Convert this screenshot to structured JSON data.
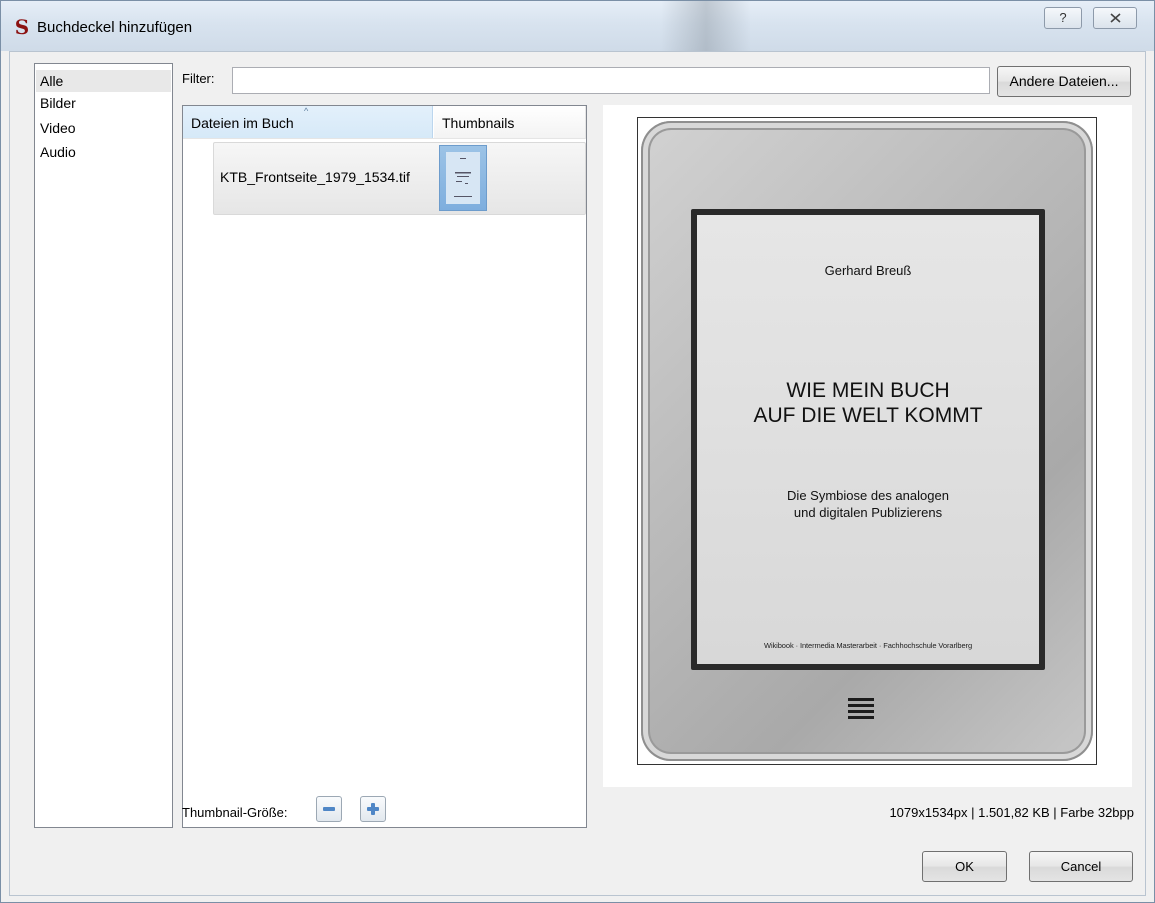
{
  "window": {
    "title": "Buchdeckel hinzufügen",
    "app_icon_glyph": "S",
    "help_glyph": "?"
  },
  "categories": [
    {
      "label": "Alle",
      "selected": true
    },
    {
      "label": "Bilder",
      "selected": false
    },
    {
      "label": "Video",
      "selected": false
    },
    {
      "label": "Audio",
      "selected": false
    }
  ],
  "filter": {
    "label": "Filter:",
    "value": "",
    "other_files_button": "Andere Dateien..."
  },
  "file_list": {
    "columns": [
      "Dateien im Buch",
      "Thumbnails"
    ],
    "rows": [
      {
        "filename": "KTB_Frontseite_1979_1534.tif"
      }
    ]
  },
  "thumbnail_size": {
    "label": "Thumbnail-Größe:"
  },
  "preview": {
    "author": "Gerhard Breuß",
    "title_line1": "WIE MEIN BUCH",
    "title_line2": "AUF DIE WELT KOMMT",
    "subtitle_line1": "Die Symbiose des analogen",
    "subtitle_line2": "und digitalen Publizierens",
    "footer": "Wikibook · Intermedia Masterarbeit · Fachhochschule Vorarlberg"
  },
  "status_text": "1079x1534px | 1.501,82 KB | Farbe 32bpp",
  "buttons": {
    "ok": "OK",
    "cancel": "Cancel"
  },
  "colors": {
    "app_icon": "#8b1010",
    "header_selected": "#d6e9f8",
    "thumbnail": "#7eaede"
  }
}
